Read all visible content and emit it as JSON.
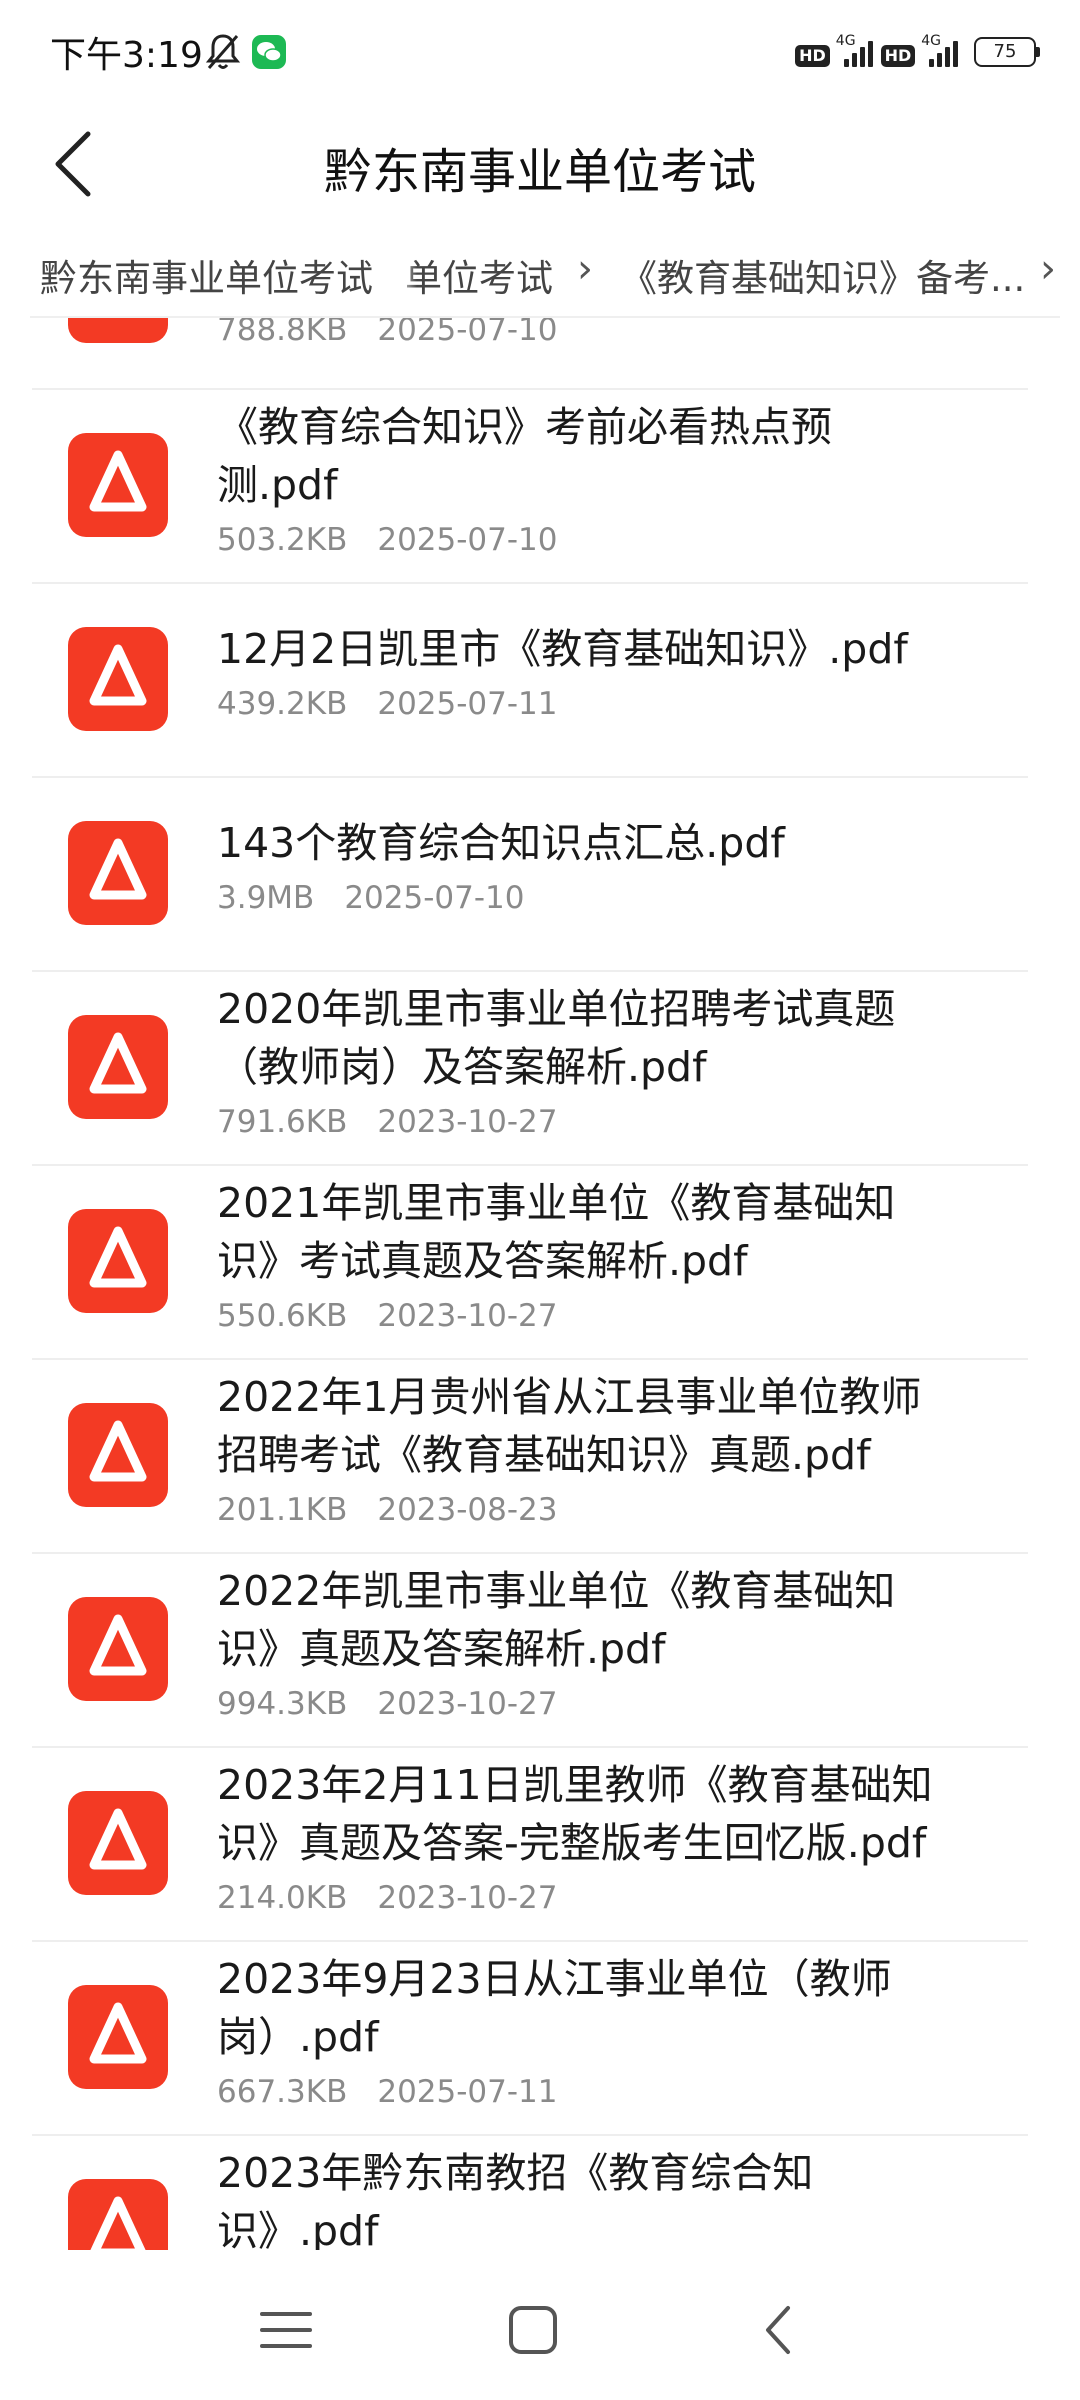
{
  "status_bar": {
    "time": "下午3:19",
    "hd_label": "HD",
    "network_label": "4G",
    "battery": "75"
  },
  "header": {
    "title": "黔东南事业单位考试"
  },
  "breadcrumb": {
    "items": [
      "黔东南事业单位考试",
      "单位考试",
      "《教育基础知识》备考..."
    ],
    "separator": "›"
  },
  "files": [
    {
      "name": "",
      "size": "788.8KB",
      "date": "2025-07-10"
    },
    {
      "name": "《教育综合知识》考前必看热点预测.pdf",
      "size": "503.2KB",
      "date": "2025-07-10"
    },
    {
      "name": "12月2日凯里市《教育基础知识》.pdf",
      "size": "439.2KB",
      "date": "2025-07-11"
    },
    {
      "name": "143个教育综合知识点汇总.pdf",
      "size": "3.9MB",
      "date": "2025-07-10"
    },
    {
      "name": "2020年凯里市事业单位招聘考试真题（教师岗）及答案解析.pdf",
      "size": "791.6KB",
      "date": "2023-10-27"
    },
    {
      "name": "2021年凯里市事业单位《教育基础知识》考试真题及答案解析.pdf",
      "size": "550.6KB",
      "date": "2023-10-27"
    },
    {
      "name": "2022年1月贵州省从江县事业单位教师招聘考试《教育基础知识》真题.pdf",
      "size": "201.1KB",
      "date": "2023-08-23"
    },
    {
      "name": "2022年凯里市事业单位《教育基础知识》真题及答案解析.pdf",
      "size": "994.3KB",
      "date": "2023-10-27"
    },
    {
      "name": "2023年2月11日凯里教师《教育基础知识》真题及答案-完整版考生回忆版.pdf",
      "size": "214.0KB",
      "date": "2023-10-27"
    },
    {
      "name": "2023年9月23日从江事业单位（教师岗）.pdf",
      "size": "667.3KB",
      "date": "2025-07-11"
    },
    {
      "name": "2023年黔东南教招《教育综合知识》.pdf",
      "size": "",
      "date": ""
    }
  ],
  "colors": {
    "pdf_icon": "#f33a24",
    "wechat": "#1db954"
  },
  "icons": {
    "back": "chevron-left-icon",
    "bell_muted": "bell-off-icon",
    "file": "pdf-icon",
    "nav_menu": "menu-icon",
    "nav_home": "home-square-icon",
    "nav_back": "nav-back-icon"
  }
}
